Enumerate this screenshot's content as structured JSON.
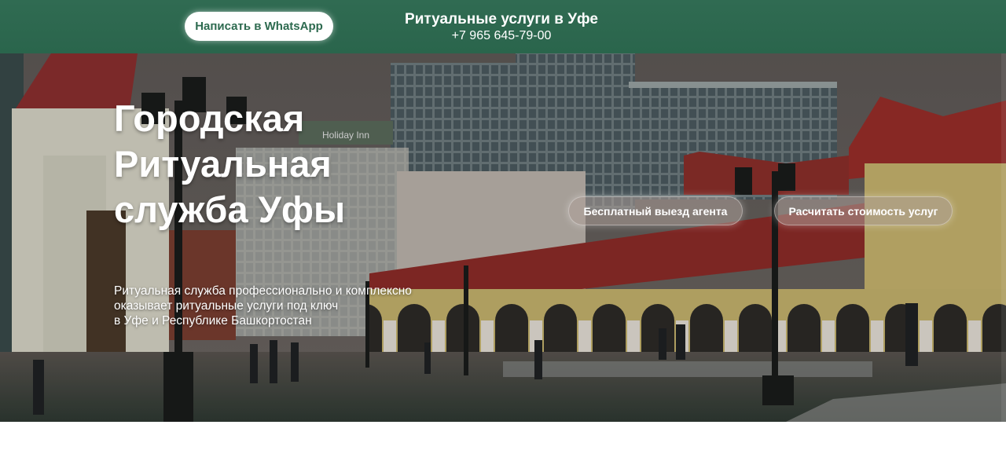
{
  "header": {
    "whatsapp_button": "Написать в WhatsApp",
    "title": "Ритуальные услуги в Уфе",
    "phone": "+7 965 645-79-00"
  },
  "hero": {
    "heading": "Городская\nРитуальная\nслужба Уфы",
    "description": "Ритуальная служба профессионально и комплексно\nоказывает ритуальные услуги под ключ\nв Уфе и Республике Башкортостан",
    "button_agent": "Бесплатный выезд агента",
    "button_calc": "Расчитать стоимость услуг",
    "background_sign": "Holiday Inn"
  },
  "colors": {
    "header_bg": "#2d6a4f",
    "button_text": "#2d6a4f",
    "heading_text": "#ffffff"
  }
}
